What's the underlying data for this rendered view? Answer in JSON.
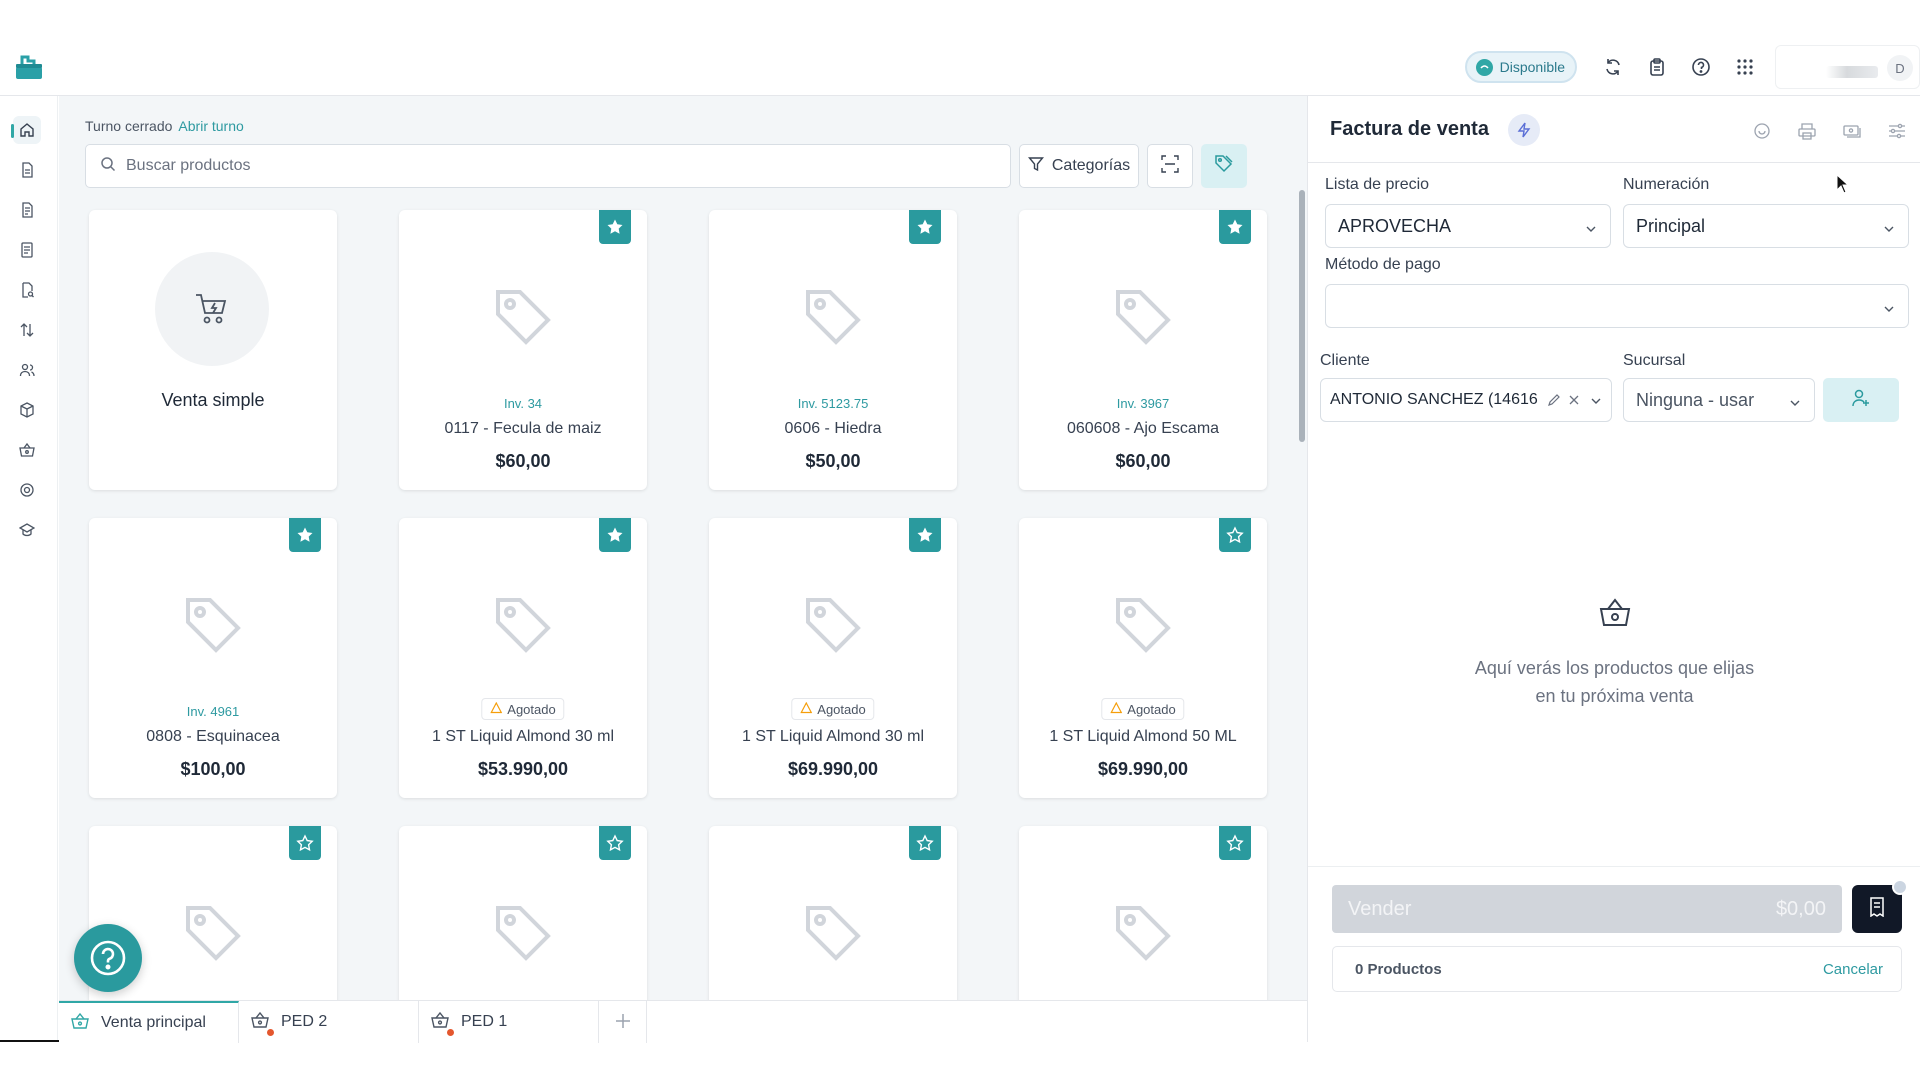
{
  "header": {
    "status_label": "Disponible",
    "user_initial": "D",
    "icons": [
      "logo-icon",
      "refresh-icon",
      "clipboard-icon",
      "help-icon",
      "apps-grid-icon"
    ]
  },
  "sidebar": {
    "items": [
      "home-icon",
      "document-icon",
      "invoice-icon",
      "receipt-icon",
      "file-search-icon",
      "transfer-icon",
      "users-icon",
      "box-icon",
      "basket-icon",
      "settings-icon",
      "graduation-icon"
    ]
  },
  "main": {
    "turno_status": "Turno cerrado",
    "turno_link": "Abrir turno",
    "search_placeholder": "Buscar productos",
    "categories_label": "Categorías",
    "simple_sale_label": "Venta simple",
    "products": [
      {
        "inv": "Inv. 34",
        "name": "0117 - Fecula de maiz",
        "price": "$60,00",
        "fav": true
      },
      {
        "inv": "Inv. 5123.75",
        "name": "0606 - Hiedra",
        "price": "$50,00",
        "fav": true
      },
      {
        "inv": "Inv. 3967",
        "name": "060608 - Ajo Escama",
        "price": "$60,00",
        "fav": true
      },
      {
        "inv": "Inv. 4961",
        "name": "0808 - Esquinacea",
        "price": "$100,00",
        "fav": true
      },
      {
        "badge": "Agotado",
        "name": "1 ST Liquid Almond 30 ml",
        "price": "$53.990,00",
        "fav": true
      },
      {
        "badge": "Agotado",
        "name": "1 ST Liquid Almond 30 ml",
        "price": "$69.990,00",
        "fav": true
      },
      {
        "badge": "Agotado",
        "name": "1 ST Liquid Almond 50 ML",
        "price": "$69.990,00",
        "fav": false
      }
    ]
  },
  "tabs": [
    {
      "label": "Venta principal",
      "active": true
    },
    {
      "label": "PED 2",
      "active": false
    },
    {
      "label": "PED 1",
      "active": false
    }
  ],
  "panel": {
    "title": "Factura de venta",
    "price_list_label": "Lista de precio",
    "price_list_value": "APROVECHA",
    "numbering_label": "Numeración",
    "numbering_value": "Principal",
    "payment_label": "Método de pago",
    "payment_value": "",
    "client_label": "Cliente",
    "client_value": "ANTONIO SANCHEZ (14616",
    "branch_label": "Sucursal",
    "branch_value": "Ninguna - usar",
    "empty_line1": "Aquí verás los productos que elijas",
    "empty_line2": "en tu próxima venta",
    "sell_label": "Vender",
    "sell_total": "$0,00",
    "products_count": "0 Productos",
    "cancel_label": "Cancelar"
  },
  "colors": {
    "accent": "#2a9a9e",
    "link": "#2e9aa1",
    "background": "#f3f6f8"
  }
}
